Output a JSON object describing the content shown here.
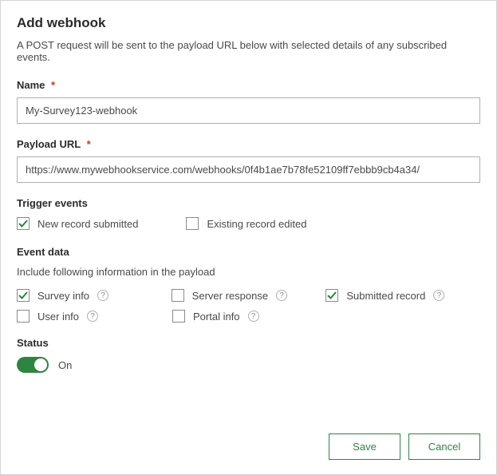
{
  "title": "Add webhook",
  "description": "A POST request will be sent to the payload URL below with selected details of any subscribed events.",
  "fields": {
    "name": {
      "label": "Name",
      "value": "My-Survey123-webhook"
    },
    "payload_url": {
      "label": "Payload URL",
      "value": "https://www.mywebhookservice.com/webhooks/0f4b1ae7b78fe52109ff7ebbb9cb4a34/"
    }
  },
  "trigger": {
    "header": "Trigger events",
    "options": {
      "new_record": {
        "label": "New record submitted",
        "checked": true
      },
      "existing_record": {
        "label": "Existing record edited",
        "checked": false
      }
    }
  },
  "event_data": {
    "header": "Event data",
    "subtext": "Include following information in the payload",
    "options": {
      "survey_info": {
        "label": "Survey info",
        "checked": true
      },
      "server_response": {
        "label": "Server response",
        "checked": false
      },
      "submitted_record": {
        "label": "Submitted record",
        "checked": true
      },
      "user_info": {
        "label": "User info",
        "checked": false
      },
      "portal_info": {
        "label": "Portal info",
        "checked": false
      }
    }
  },
  "status": {
    "header": "Status",
    "label": "On",
    "on": true
  },
  "buttons": {
    "save": "Save",
    "cancel": "Cancel"
  },
  "required_marker": "*",
  "help_glyph": "?"
}
